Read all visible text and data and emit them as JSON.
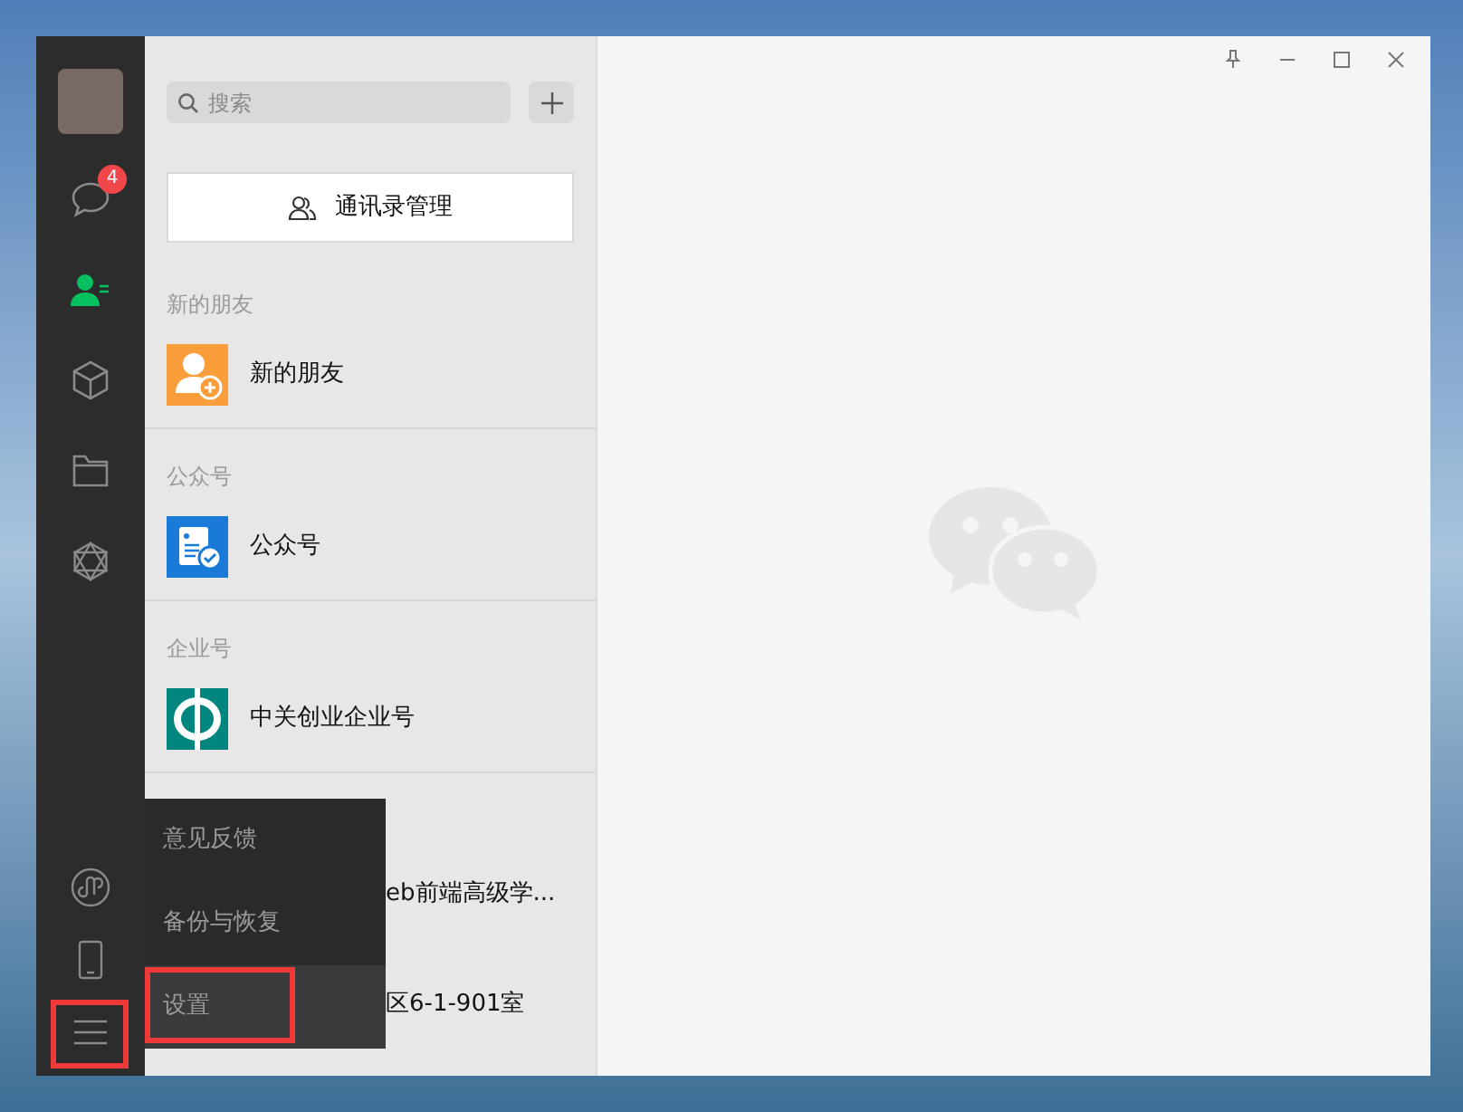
{
  "sidebar": {
    "items": [
      {
        "kind": "chats",
        "selected": false,
        "badge": "4"
      },
      {
        "kind": "contacts",
        "selected": true
      },
      {
        "kind": "cube",
        "selected": false
      },
      {
        "kind": "folder",
        "selected": false
      },
      {
        "kind": "moments",
        "selected": false
      }
    ],
    "bottom_items": [
      {
        "kind": "miniprogram",
        "annotated": false
      },
      {
        "kind": "phone",
        "annotated": false
      },
      {
        "kind": "menu",
        "annotated": true
      }
    ]
  },
  "search": {
    "placeholder": "搜索"
  },
  "manage_button": "通讯录管理",
  "sections": [
    {
      "header": "新的朋友",
      "items": [
        {
          "name": "新的朋友",
          "kind": "new-friend"
        }
      ]
    },
    {
      "header": "公众号",
      "items": [
        {
          "name": "公众号",
          "kind": "official"
        }
      ]
    },
    {
      "header": "企业号",
      "items": [
        {
          "name": "中关创业企业号",
          "kind": "enterprise"
        }
      ]
    }
  ],
  "covered_rows": [
    "eb前端高级学...",
    "区6-1-901室"
  ],
  "menu": {
    "items": [
      {
        "label": "意见反馈",
        "selected": false,
        "annotated": false
      },
      {
        "label": "备份与恢复",
        "selected": false,
        "annotated": false
      },
      {
        "label": "设置",
        "selected": true,
        "annotated": true
      }
    ]
  }
}
